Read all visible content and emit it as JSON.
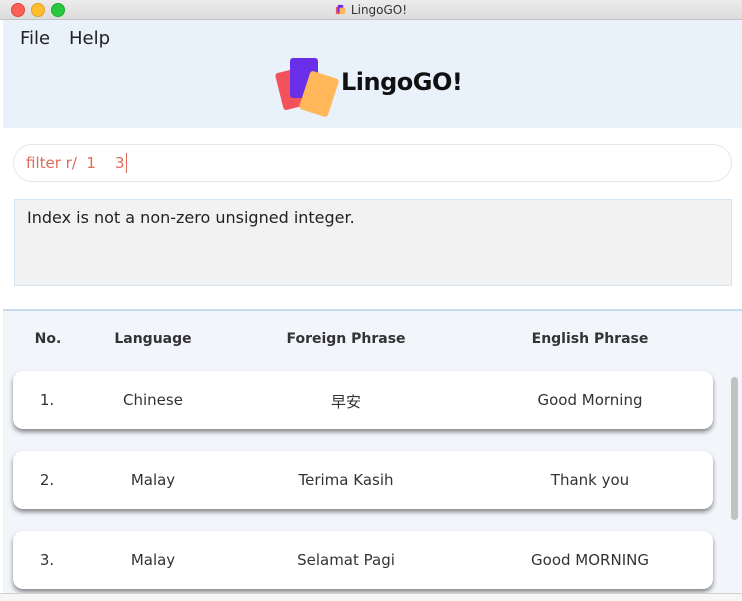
{
  "window": {
    "title": "LingoGO!"
  },
  "menu": {
    "items": [
      "File",
      "Help"
    ]
  },
  "logo": {
    "text": "LingoGO!"
  },
  "command": {
    "value": "filter r/  1    3"
  },
  "result": {
    "message": "Index is not a non-zero unsigned integer."
  },
  "table": {
    "headers": [
      "No.",
      "Language",
      "Foreign Phrase",
      "English Phrase"
    ],
    "rows": [
      {
        "no": "1.",
        "language": "Chinese",
        "foreign": "早安",
        "english": "Good Morning"
      },
      {
        "no": "2.",
        "language": "Malay",
        "foreign": "Terima Kasih",
        "english": "Thank you"
      },
      {
        "no": "3.",
        "language": "Malay",
        "foreign": "Selamat Pagi",
        "english": "Good MORNING"
      }
    ]
  },
  "colors": {
    "header_bg": "#e9f1fb",
    "command_text": "#e06b5a",
    "list_bg": "#f2f5fa",
    "logo_purple": "#6a2ee8",
    "logo_red": "#f2525a",
    "logo_orange": "#ffb759"
  }
}
